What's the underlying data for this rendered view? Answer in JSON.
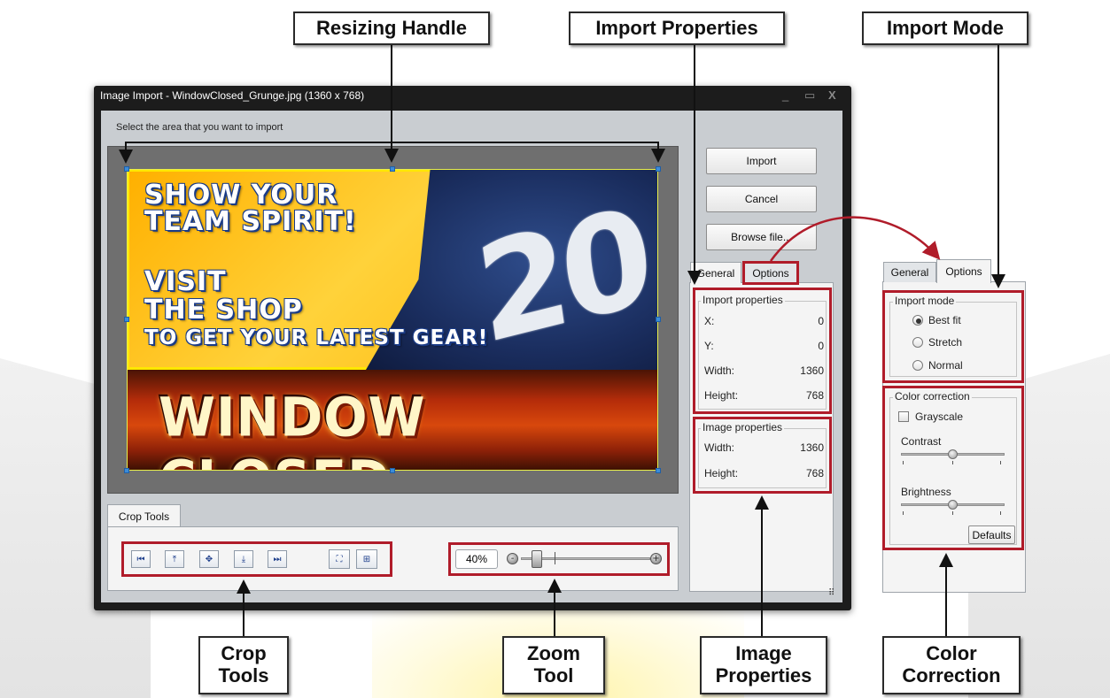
{
  "callouts": {
    "resizing_handle": "Resizing Handle",
    "import_properties": "Import Properties",
    "import_mode": "Import Mode",
    "crop_tools": "Crop\nTools",
    "zoom_tool": "Zoom\nTool",
    "image_properties": "Image\nProperties",
    "color_correction": "Color\nCorrection"
  },
  "window": {
    "title": "Image Import - WindowClosed_Grunge.jpg  (1360 x 768)",
    "minimize_glyph": "_",
    "maximize_glyph": "▭",
    "close_glyph": "X",
    "instruction": "Select the area that you want to import"
  },
  "banner": {
    "line1": "SHOW YOUR",
    "line2": "TEAM SPIRIT!",
    "line3": "VISIT",
    "line4": "THE SHOP",
    "line5": "TO GET YOUR LATEST GEAR!",
    "jersey_number": "20",
    "closed": "WINDOW CLOSED"
  },
  "actions": {
    "import": "Import",
    "cancel": "Cancel",
    "browse": "Browse file..."
  },
  "tabs": {
    "general": "General",
    "options": "Options"
  },
  "import_properties": {
    "title": "Import properties",
    "rows": [
      {
        "label": "X:",
        "value": "0"
      },
      {
        "label": "Y:",
        "value": "0"
      },
      {
        "label": "Width:",
        "value": "1360"
      },
      {
        "label": "Height:",
        "value": "768"
      }
    ]
  },
  "image_properties": {
    "title": "Image properties",
    "rows": [
      {
        "label": "Width:",
        "value": "1360"
      },
      {
        "label": "Height:",
        "value": "768"
      }
    ]
  },
  "crop_tools": {
    "tab_label": "Crop Tools",
    "icons": [
      "align-left-icon",
      "align-top-icon",
      "center-icon",
      "align-bottom-icon",
      "align-right-icon",
      "fit-frame-icon",
      "fit-width-icon"
    ]
  },
  "zoom": {
    "value": "40%",
    "minus": "-",
    "plus": "+",
    "level_percent": 40
  },
  "options_panel": {
    "import_mode_title": "Import mode",
    "modes": [
      {
        "label": "Best fit",
        "selected": true
      },
      {
        "label": "Stretch",
        "selected": false
      },
      {
        "label": "Normal",
        "selected": false
      }
    ],
    "color_correction_title": "Color correction",
    "grayscale": "Grayscale",
    "grayscale_checked": false,
    "contrast": "Contrast",
    "brightness": "Brightness",
    "contrast_level": 0.5,
    "brightness_level": 0.5,
    "defaults": "Defaults"
  },
  "colors": {
    "highlight_red": "#b01c2a",
    "arrow_red": "#b01c2a",
    "window_frame": "#1c1c1c",
    "client_bg": "#c9cdd1",
    "handle_blue": "#3b8bd8"
  }
}
